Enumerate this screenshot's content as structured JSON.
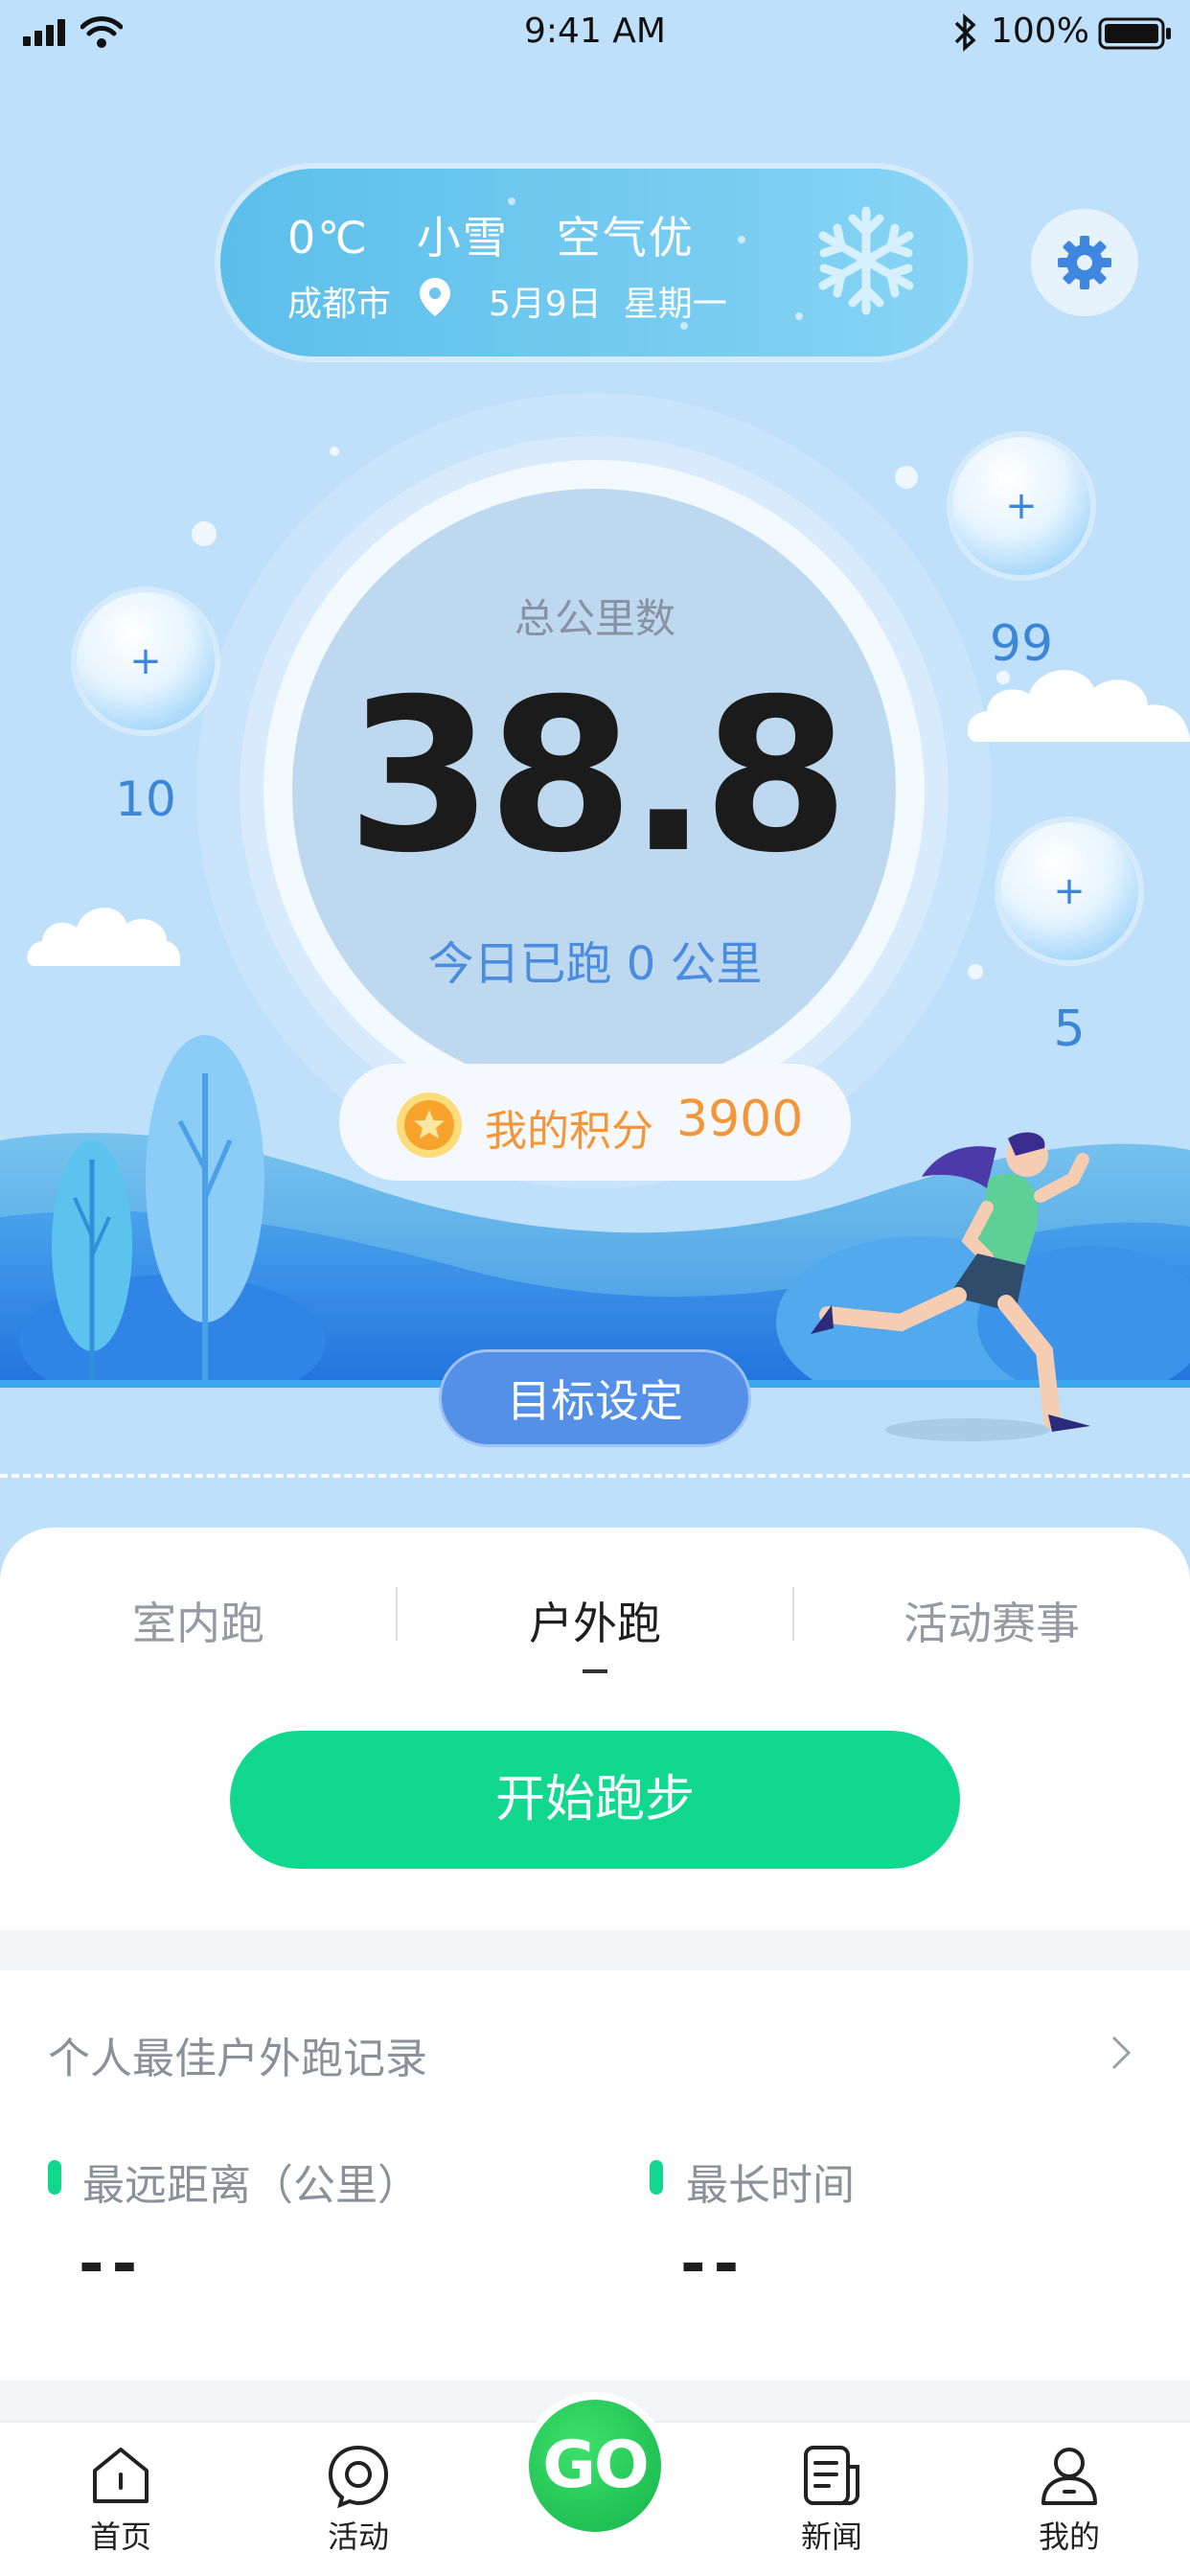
{
  "status_bar": {
    "time": "9:41 AM",
    "battery": "100%"
  },
  "weather": {
    "temperature": "0℃",
    "condition": "小雪",
    "air": "空气优",
    "city": "成都市",
    "date": "5月9日",
    "weekday": "星期一"
  },
  "summary": {
    "label": "总公里数",
    "total_km": "38.8",
    "today_prefix": "今日已跑",
    "today_value": "0",
    "today_unit": "公里"
  },
  "bubbles": [
    {
      "sign": "+",
      "value": "10"
    },
    {
      "sign": "+",
      "value": "99"
    },
    {
      "sign": "+",
      "value": "5"
    }
  ],
  "points": {
    "label": "我的积分",
    "value": "3900"
  },
  "goal_button": "目标设定",
  "tabs": [
    {
      "label": "室内跑",
      "active": false
    },
    {
      "label": "户外跑",
      "active": true
    },
    {
      "label": "活动赛事",
      "active": false
    }
  ],
  "start_button": "开始跑步",
  "records": {
    "title": "个人最佳户外跑记录",
    "items": [
      {
        "label": "最远距离（公里）",
        "value": "--"
      },
      {
        "label": "最长时间",
        "value": "--"
      }
    ]
  },
  "tabbar": {
    "items": [
      {
        "label": "首页",
        "icon": "home-icon"
      },
      {
        "label": "活动",
        "icon": "activity-icon"
      },
      {
        "label": "新闻",
        "icon": "news-icon"
      },
      {
        "label": "我的",
        "icon": "profile-icon"
      }
    ],
    "center": "GO"
  },
  "colors": {
    "background": "#bfe0fb",
    "accent_green": "#12d88f",
    "points_orange": "#f29637",
    "goal_blue": "#5590e8",
    "today_blue": "#4a8ce0"
  }
}
